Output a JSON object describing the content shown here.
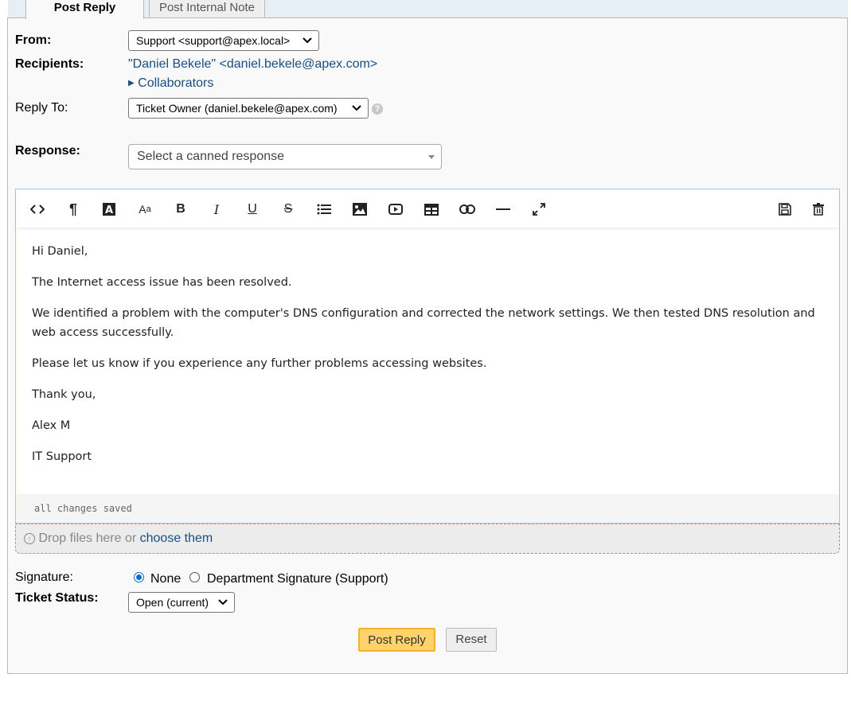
{
  "tabs": [
    {
      "label": "Post Reply",
      "active": true
    },
    {
      "label": "Post Internal Note",
      "active": false
    }
  ],
  "form": {
    "from_label": "From:",
    "from_value": "Support <support@apex.local>",
    "recipients_label": "Recipients:",
    "recipient_name": "\"Daniel Bekele\"",
    "recipient_email": " <daniel.bekele@apex.com>",
    "collaborators_label": "Collaborators",
    "reply_to_label": "Reply To:",
    "reply_to_value": "Ticket Owner (daniel.bekele@apex.com)",
    "response_label": "Response:",
    "canned_placeholder": "Select a canned response"
  },
  "editor": {
    "toolbar_icons": [
      "code-view-icon",
      "paragraph-icon",
      "font-color-icon",
      "font-size-icon",
      "bold-icon",
      "italic-icon",
      "underline-icon",
      "strikethrough-icon",
      "list-icon",
      "image-icon",
      "video-icon",
      "table-icon",
      "link-icon",
      "horizontal-rule-icon",
      "fullscreen-icon",
      "save-draft-icon",
      "delete-draft-icon"
    ],
    "paragraphs": [
      "Hi Daniel,",
      "The Internet access issue has been resolved.",
      "We identified a problem with the computer's DNS configuration and corrected the network settings. We then tested DNS resolution and web access successfully.",
      "Please let us know if you experience any further problems accessing websites.",
      "Thank you,",
      "Alex M",
      "IT Support"
    ],
    "status": "all changes saved"
  },
  "dropzone": {
    "text": "Drop files here or ",
    "link": "choose them"
  },
  "signature": {
    "label": "Signature:",
    "options": [
      {
        "label": "None",
        "selected": true
      },
      {
        "label": "Department Signature (Support)",
        "selected": false
      }
    ]
  },
  "ticket_status": {
    "label": "Ticket Status:",
    "value": "Open (current)"
  },
  "buttons": {
    "post_reply": "Post Reply",
    "reset": "Reset"
  },
  "colors": {
    "link": "#184e81",
    "primary_button": "#ffd36a",
    "radio_selected": "#0b6cd4"
  }
}
